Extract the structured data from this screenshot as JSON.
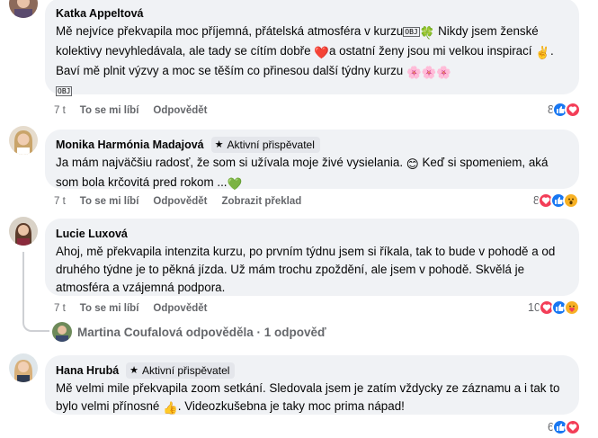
{
  "comments": [
    {
      "author": "Katka Appeltová",
      "text_a": "Mě nejvíce překvapila moc příjemná, přátelská atmosféra v kurzu",
      "emoji_a": "🍀",
      "text_b": " Nikdy jsem ženské kolektivy nevyhledávala, ale tady se cítím dobře ",
      "emoji_b": "❤️",
      "text_c": "a ostatní ženy jsou mi velkou inspirací ",
      "emoji_c": "✌️",
      "text_d": ". Baví mě plnit výzvy a moc se těším co přinesou další týdny kurzu ",
      "emoji_d": "🌸🌸🌸",
      "box_glyph": "OBJ",
      "time": "7 t",
      "like": "To se mi líbí",
      "reply": "Odpovědět",
      "reaction_count": "8",
      "reactions": [
        "like-icon",
        "love-icon"
      ]
    },
    {
      "author": "Monika Harmónia Madajová",
      "badge": "Aktivní přispěvatel",
      "text_a": "Ja mám najväčšiu radosť, že som si užívala moje živé vysielania. ",
      "emoji_a": "😊",
      "text_b": " Keď si spomeniem, aká som bola krčovitá pred rokom ...",
      "emoji_b": "💚",
      "time": "7 t",
      "like": "To se mi líbí",
      "reply": "Odpovědět",
      "translate": "Zobrazit překlad",
      "reaction_count": "8",
      "reactions": [
        "love-icon",
        "like-icon",
        "wow-icon"
      ]
    },
    {
      "author": "Lucie Luxová",
      "text": "Ahoj, mě překvapila intenzita kurzu, po prvním týdnu jsem si říkala, tak to bude v pohodě a od druhého týdne je to pěkná jízda. Už mám trochu zpoždění, ale jsem v pohodě. Skvělá je atmosféra a vzájemná podpora.",
      "time": "7 t",
      "like": "To se mi líbí",
      "reply": "Odpovědět",
      "reaction_count": "10",
      "reactions": [
        "love-icon",
        "like-icon",
        "care-icon"
      ],
      "replies_link": "Martina Coufalová odpověděla · 1 odpověď"
    },
    {
      "author": "Hana Hrubá",
      "badge": "Aktivní přispěvatel",
      "text_a": "Mě velmi mile překvapila zoom setkání. Sledovala jsem je zatím vždycky ze záznamu a i tak to bylo velmi přínosné ",
      "emoji_a": "👍",
      "text_b": ". Videozkušebna je taky moc prima nápad!",
      "time": "7 t",
      "like": "To se mi líbí",
      "reply": "Odpovědět",
      "reaction_count": "6",
      "reactions": [
        "like-icon",
        "love-icon"
      ]
    }
  ],
  "colors": {
    "bubble": "#f0f2f5",
    "muted": "#65676b",
    "like": "#1877f2",
    "love": "#f33e58",
    "wow": "#f7b125"
  }
}
